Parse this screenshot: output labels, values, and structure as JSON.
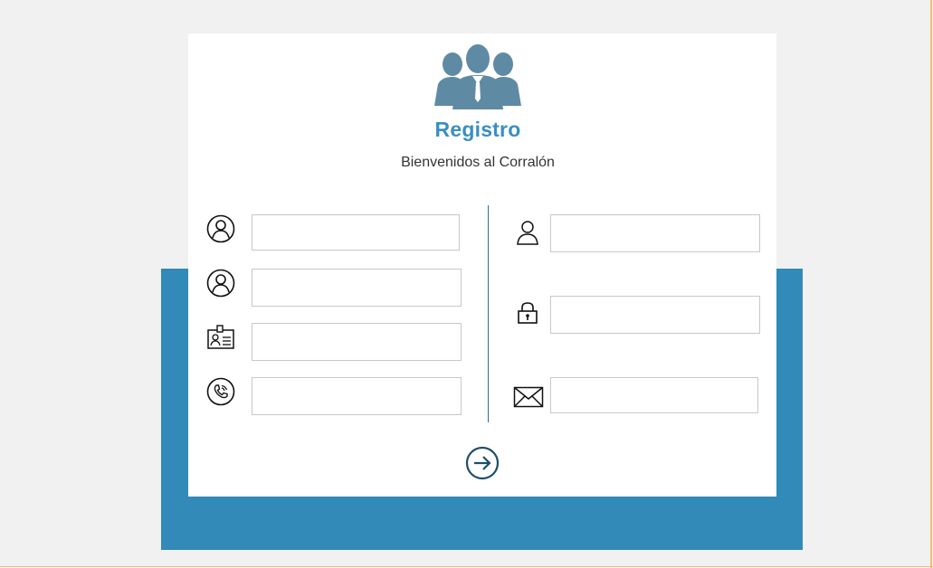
{
  "header": {
    "title": "Registro",
    "subtitle": "Bienvenidos al Corralón",
    "logo_icon": "group-users-icon"
  },
  "left_fields": [
    {
      "icon": "user-circle-icon",
      "value": "",
      "placeholder": ""
    },
    {
      "icon": "user-circle-icon",
      "value": "",
      "placeholder": ""
    },
    {
      "icon": "id-card-icon",
      "value": "",
      "placeholder": ""
    },
    {
      "icon": "phone-icon",
      "value": "",
      "placeholder": ""
    }
  ],
  "right_fields": [
    {
      "icon": "user-icon",
      "value": "",
      "placeholder": ""
    },
    {
      "icon": "lock-icon",
      "value": "",
      "placeholder": ""
    },
    {
      "icon": "envelope-icon",
      "value": "",
      "placeholder": ""
    }
  ],
  "submit": {
    "icon": "arrow-right-circle-icon"
  },
  "colors": {
    "accent": "#318ab8",
    "title": "#3a8fc0",
    "icon_dark": "#1d4e6b",
    "logo": "#5f8aa3",
    "background": "#f1f1f1",
    "frame": "#f0c070"
  }
}
